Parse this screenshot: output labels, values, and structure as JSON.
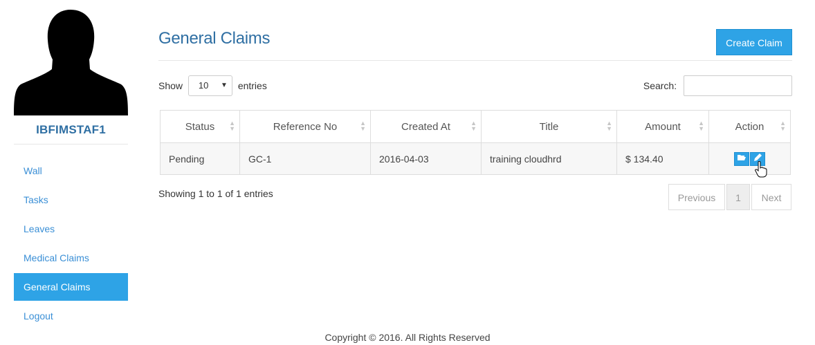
{
  "sidebar": {
    "username": "IBFIMSTAF1",
    "items": [
      {
        "label": "Wall"
      },
      {
        "label": "Tasks"
      },
      {
        "label": "Leaves"
      },
      {
        "label": "Medical Claims"
      },
      {
        "label": "General Claims",
        "active": true
      },
      {
        "label": "Logout"
      }
    ]
  },
  "main": {
    "title": "General Claims",
    "create_label": "Create Claim",
    "show_label": "Show",
    "entries_label": "entries",
    "page_size": "10",
    "search_label": "Search:",
    "search_value": ""
  },
  "table": {
    "columns": [
      "Status",
      "Reference No",
      "Created At",
      "Title",
      "Amount",
      "Action"
    ],
    "rows": [
      {
        "status": "Pending",
        "reference": "GC-1",
        "created_at": "2016-04-03",
        "title": "training cloudhrd",
        "amount": "$ 134.40"
      }
    ]
  },
  "pagination": {
    "info": "Showing 1 to 1 of 1 entries",
    "previous": "Previous",
    "current": "1",
    "next": "Next"
  },
  "footer": {
    "copyright": "Copyright © 2016. All Rights Reserved"
  },
  "icons": {
    "view": "folder-open-icon",
    "edit": "pencil-icon",
    "sort": "sort-icon",
    "cursor": "hand-pointer-icon"
  },
  "colors": {
    "accent": "#2ea3e6",
    "title": "#2f6fa3",
    "link": "#3a8fd6"
  }
}
